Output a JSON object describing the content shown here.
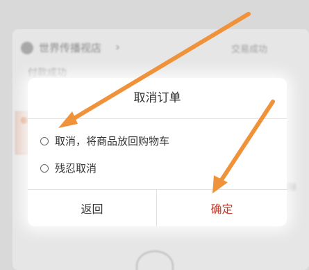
{
  "background": {
    "shop_name": "世界传播视店",
    "chevron": "›",
    "status_right": "交易成功",
    "pay_status": "付款成功",
    "right_text": "删除"
  },
  "dialog": {
    "title": "取消订单",
    "options": [
      {
        "label": "取消，将商品放回购物车",
        "selected": false
      },
      {
        "label": "残忍取消",
        "selected": false
      }
    ],
    "buttons": {
      "back": "返回",
      "confirm": "确定"
    }
  },
  "colors": {
    "arrow": "#f0923a",
    "confirm_text": "#c0392b",
    "overlay": "#d9d9d9"
  },
  "annotations": {
    "arrows": [
      "arrow-to-option-1",
      "arrow-to-confirm-button"
    ]
  }
}
